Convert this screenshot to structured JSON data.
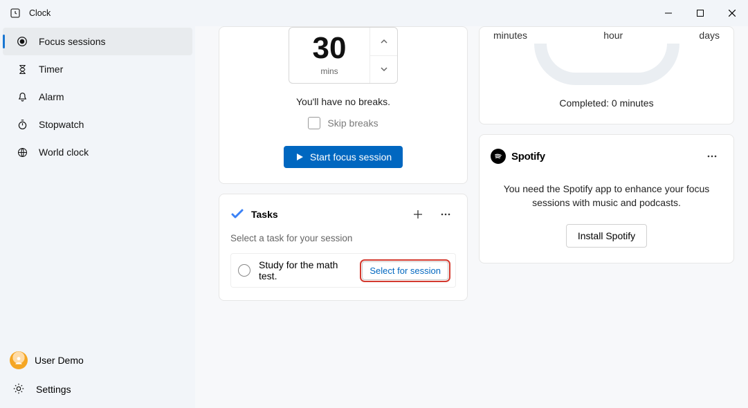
{
  "titlebar": {
    "app_name": "Clock"
  },
  "sidebar": {
    "items": [
      {
        "label": "Focus sessions"
      },
      {
        "label": "Timer"
      },
      {
        "label": "Alarm"
      },
      {
        "label": "Stopwatch"
      },
      {
        "label": "World clock"
      }
    ],
    "user_name": "User Demo",
    "settings_label": "Settings"
  },
  "focus": {
    "duration_value": "30",
    "duration_unit": "mins",
    "breaks_text": "You'll have no breaks.",
    "skip_label": "Skip breaks",
    "start_label": "Start focus session"
  },
  "tasks": {
    "title": "Tasks",
    "hint": "Select a task for your session",
    "items": [
      {
        "text": "Study for the math test.",
        "select_label": "Select for session"
      }
    ]
  },
  "progress": {
    "labels": {
      "left": "minutes",
      "mid": "hour",
      "right": "days"
    },
    "completed": "Completed: 0 minutes"
  },
  "spotify": {
    "name": "Spotify",
    "message": "You need the Spotify app to enhance your focus sessions with music and podcasts.",
    "install_label": "Install Spotify"
  }
}
